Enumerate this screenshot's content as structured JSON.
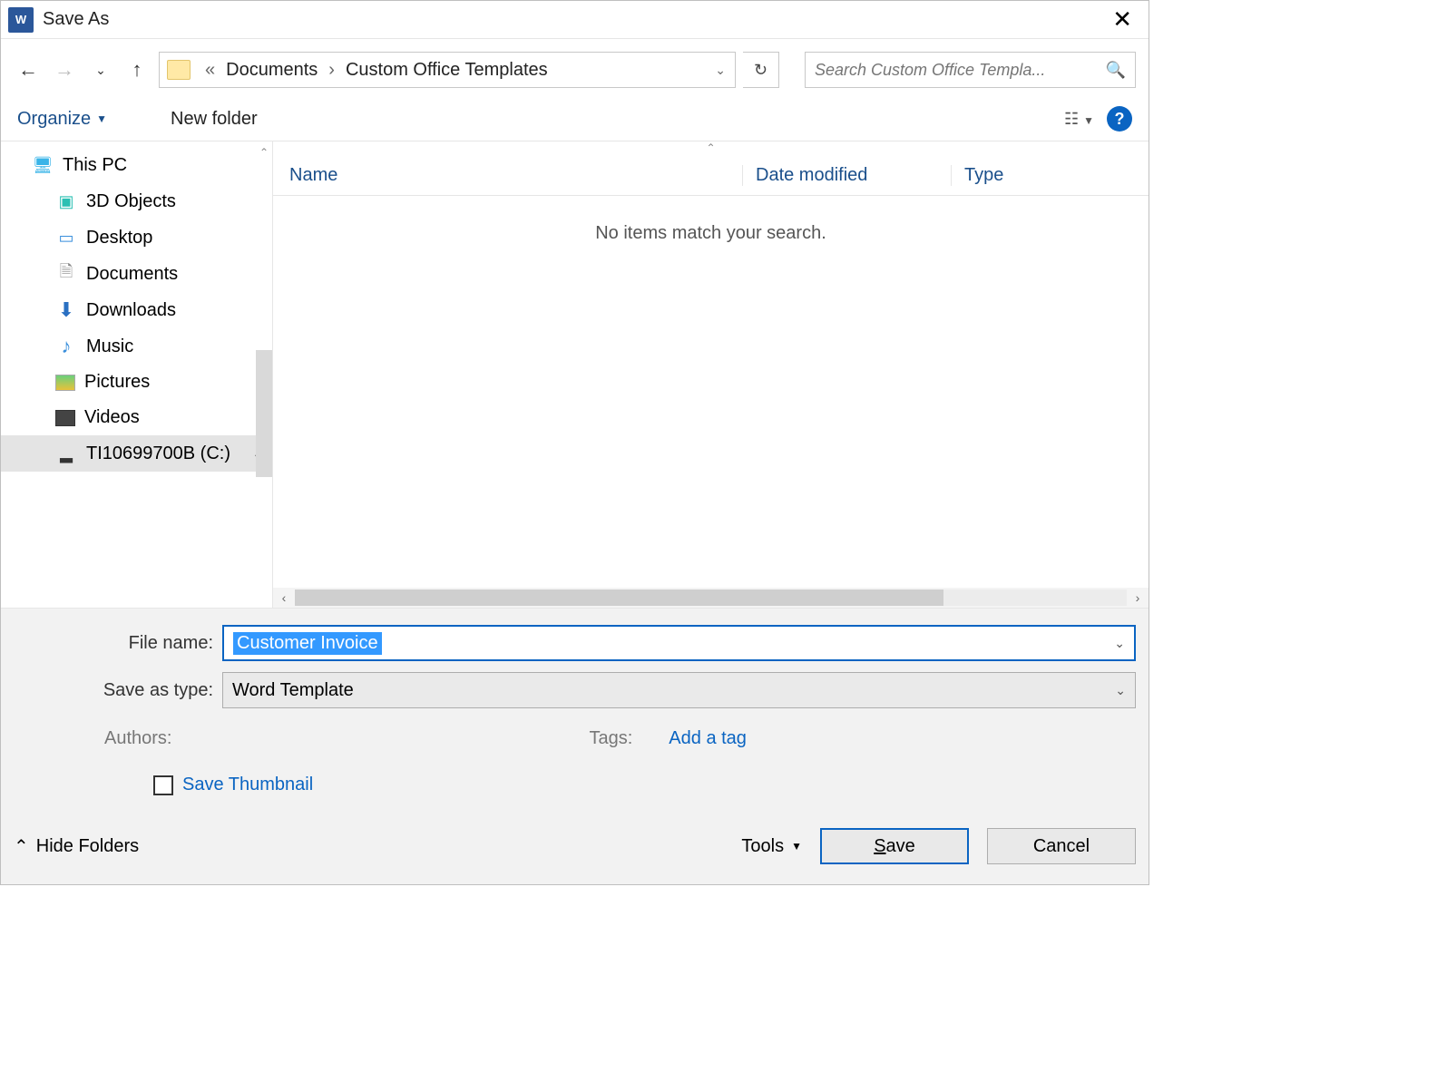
{
  "title": "Save As",
  "breadcrumb": {
    "overflow": "«",
    "parts": [
      "Documents",
      "Custom Office Templates"
    ]
  },
  "search": {
    "placeholder": "Search Custom Office Templa..."
  },
  "toolbar": {
    "organize": "Organize",
    "newfolder": "New folder"
  },
  "sidebar": {
    "root": "This PC",
    "items": [
      {
        "label": "3D Objects",
        "icon": "cube"
      },
      {
        "label": "Desktop",
        "icon": "desktop"
      },
      {
        "label": "Documents",
        "icon": "doc"
      },
      {
        "label": "Downloads",
        "icon": "down"
      },
      {
        "label": "Music",
        "icon": "music"
      },
      {
        "label": "Pictures",
        "icon": "pic"
      },
      {
        "label": "Videos",
        "icon": "vid"
      },
      {
        "label": "TI10699700B (C:)",
        "icon": "drive"
      }
    ]
  },
  "list": {
    "columns": {
      "name": "Name",
      "date": "Date modified",
      "type": "Type"
    },
    "empty": "No items match your search."
  },
  "form": {
    "filename_label": "File name:",
    "filename_value": "Customer Invoice",
    "type_label": "Save as type:",
    "type_value": "Word Template",
    "authors_label": "Authors:",
    "tags_label": "Tags:",
    "addtag": "Add a tag",
    "save_thumbnail": "Save Thumbnail"
  },
  "footer": {
    "hide_folders": "Hide Folders",
    "tools": "Tools",
    "save": "Save",
    "cancel": "Cancel"
  }
}
